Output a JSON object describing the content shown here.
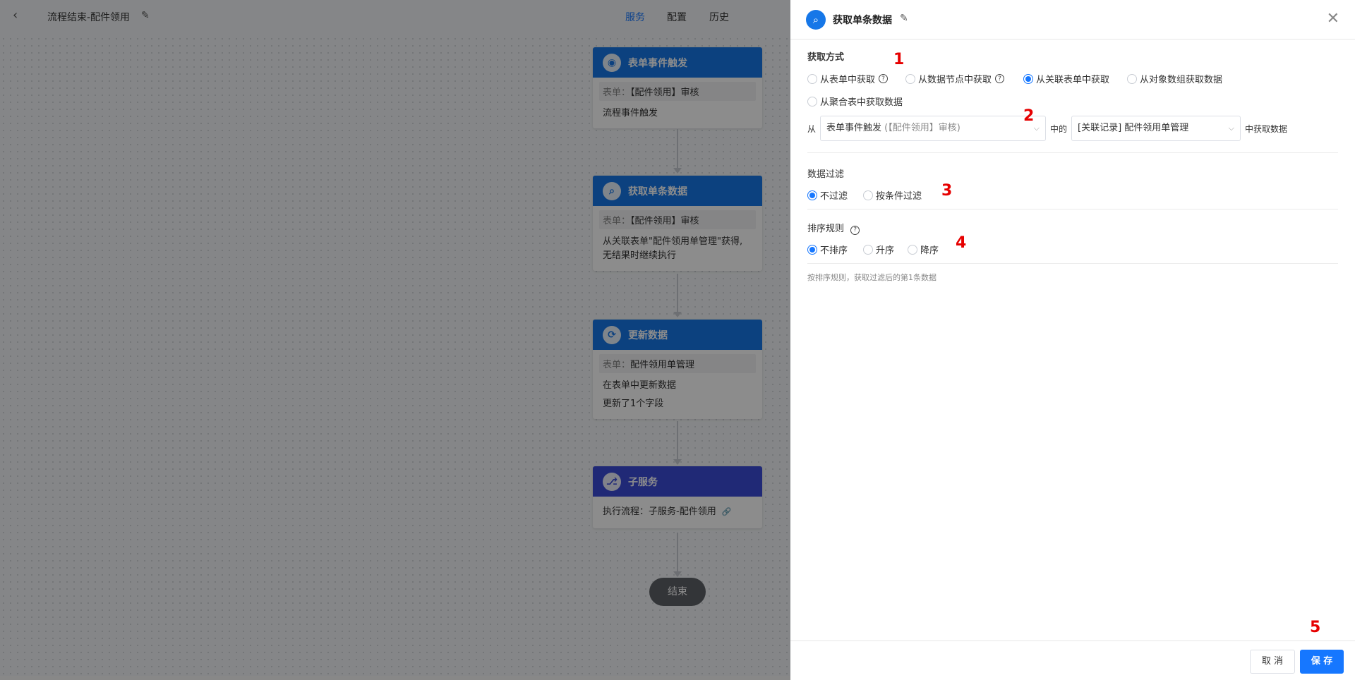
{
  "topbar": {
    "back_icon": "‹",
    "flow_title": "流程结束-配件领用",
    "edit_icon": "✎",
    "tabs": [
      {
        "label": "服务",
        "active": true
      },
      {
        "label": "配置",
        "active": false
      },
      {
        "label": "历史",
        "active": false
      }
    ]
  },
  "nodes": {
    "trigger": {
      "icon": "◉",
      "title": "表单事件触发",
      "form_label": "表单：",
      "form_value": "【配件领用】审核",
      "line1": "流程事件触发"
    },
    "get_single": {
      "icon": "⌕",
      "title": "获取单条数据",
      "form_label": "表单：",
      "form_value": "【配件领用】审核",
      "line1": "从关联表单\"配件领用单管理\"获得,",
      "line2": "无结果时继续执行"
    },
    "update": {
      "icon": "⟳",
      "title": "更新数据",
      "form_label": "表单：",
      "form_value": "配件领用单管理",
      "line1": "在表单中更新数据",
      "line2": "更新了1个字段"
    },
    "subservice": {
      "icon": "⎇",
      "title": "子服务",
      "line1": "执行流程：子服务-配件领用",
      "link_icon": "🔗"
    },
    "end_label": "结束"
  },
  "panel": {
    "head_icon": "⌕",
    "title": "获取单条数据",
    "edit_icon": "✎",
    "close_icon": "✕",
    "fetch_method": {
      "label": "获取方式",
      "options": [
        {
          "label": "从表单中获取",
          "checked": false,
          "help": true
        },
        {
          "label": "从数据节点中获取",
          "checked": false,
          "help": true
        },
        {
          "label": "从关联表单中获取",
          "checked": true,
          "help": false
        },
        {
          "label": "从对象数组获取数据",
          "checked": false,
          "help": false
        },
        {
          "label": "从聚合表中获取数据",
          "checked": false,
          "help": false
        }
      ]
    },
    "source_row": {
      "from_text": "从",
      "source_select_main": "表单事件触发",
      "source_select_muted": "(【配件领用】审核)",
      "middle_text": "中的",
      "relation_select": "[关联记录] 配件领用单管理",
      "suffix_text": "中获取数据"
    },
    "filter": {
      "label": "数据过滤",
      "options": [
        {
          "label": "不过滤",
          "checked": true
        },
        {
          "label": "按条件过滤",
          "checked": false
        }
      ]
    },
    "sort": {
      "label": "排序规则",
      "help": true,
      "options": [
        {
          "label": "不排序",
          "checked": true
        },
        {
          "label": "升序",
          "checked": false
        },
        {
          "label": "降序",
          "checked": false
        }
      ]
    },
    "hint": "按排序规则，获取过滤后的第1条数据",
    "footer": {
      "cancel": "取 消",
      "save": "保 存"
    }
  },
  "markers": [
    "1",
    "2",
    "3",
    "4",
    "5"
  ],
  "colors": {
    "primary": "#1677ff",
    "node_blue": "#1677e8",
    "node_purple": "#3b4bd8",
    "marker_red": "#e60000"
  }
}
